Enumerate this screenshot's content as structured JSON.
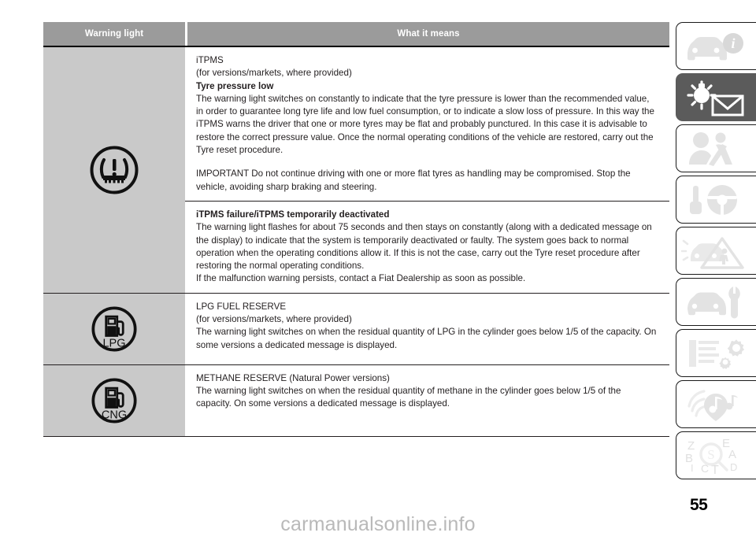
{
  "document": {
    "page_number": "55",
    "watermark": "carmanualsonline.info"
  },
  "table": {
    "headers": {
      "warning_light": "Warning light",
      "what_it_means": "What it means"
    },
    "rows": [
      {
        "icon_name": "tpms-warning-light-icon",
        "icon_label": "",
        "sections": [
          {
            "lines": [
              {
                "text": "iTPMS",
                "bold": false
              },
              {
                "text": "(for versions/markets, where provided)",
                "bold": false
              },
              {
                "text": "Tyre pressure low",
                "bold": true
              },
              {
                "text": "The warning light switches on constantly to indicate that the tyre pressure is lower than the recommended value, in order to guarantee long tyre life and low fuel consumption, or to indicate a slow loss of pressure. In this way the iTPMS warns the driver that one or more tyres may be flat and probably punctured. In this case it is advisable to restore the correct pressure value. Once the normal operating conditions of the vehicle are restored, carry out the Tyre reset procedure.",
                "bold": false
              },
              {
                "text": "",
                "bold": false
              },
              {
                "text": "IMPORTANT Do not continue driving with one or more flat tyres as handling may be compromised. Stop the vehicle, avoiding sharp braking and steering.",
                "bold": false
              }
            ]
          },
          {
            "lines": [
              {
                "text": "iTPMS failure/iTPMS temporarily deactivated",
                "bold": true
              },
              {
                "text": "The warning light flashes for about 75 seconds and then stays on constantly (along with a dedicated message on the display) to indicate that the system is temporarily deactivated or faulty. The system goes back to normal operation when the operating conditions allow it. If this is not the case, carry out the Tyre reset procedure after restoring the normal operating conditions.",
                "bold": false
              },
              {
                "text": "If the malfunction warning persists, contact a Fiat Dealership as soon as possible.",
                "bold": false
              }
            ]
          }
        ]
      },
      {
        "icon_name": "lpg-fuel-reserve-icon",
        "icon_label": "LPG",
        "sections": [
          {
            "lines": [
              {
                "text": "LPG FUEL RESERVE",
                "bold": false
              },
              {
                "text": "(for versions/markets, where provided)",
                "bold": false
              },
              {
                "text": "The warning light switches on when the residual quantity of LPG in the cylinder goes below 1/5 of the capacity. On some versions a dedicated message is displayed.",
                "bold": false
              }
            ]
          }
        ]
      },
      {
        "icon_name": "cng-methane-reserve-icon",
        "icon_label": "CNG",
        "sections": [
          {
            "lines": [
              {
                "text": "METHANE RESERVE (Natural Power versions)",
                "bold": false
              },
              {
                "text": "The warning light switches on when the residual quantity of methane in the cylinder goes below 1/5 of the capacity. On some versions a dedicated message is displayed.",
                "bold": false
              }
            ]
          }
        ]
      }
    ]
  },
  "sidebar": {
    "active_index": 1,
    "active_color": "#5b5b5b",
    "tabs": [
      {
        "icon": "car-info-icon",
        "label": ""
      },
      {
        "icon": "warning-light-message-icon",
        "label": ""
      },
      {
        "icon": "seatbelt-occupant-safety-icon",
        "label": ""
      },
      {
        "icon": "key-steering-wheel-icon",
        "label": ""
      },
      {
        "icon": "emergency-breakdown-icon",
        "label": ""
      },
      {
        "icon": "car-maintenance-wrench-icon",
        "label": ""
      },
      {
        "icon": "technical-specifications-icon",
        "label": ""
      },
      {
        "icon": "multimedia-audio-icon",
        "label": ""
      },
      {
        "icon": "alphabetical-index-icon",
        "label": ""
      }
    ]
  }
}
